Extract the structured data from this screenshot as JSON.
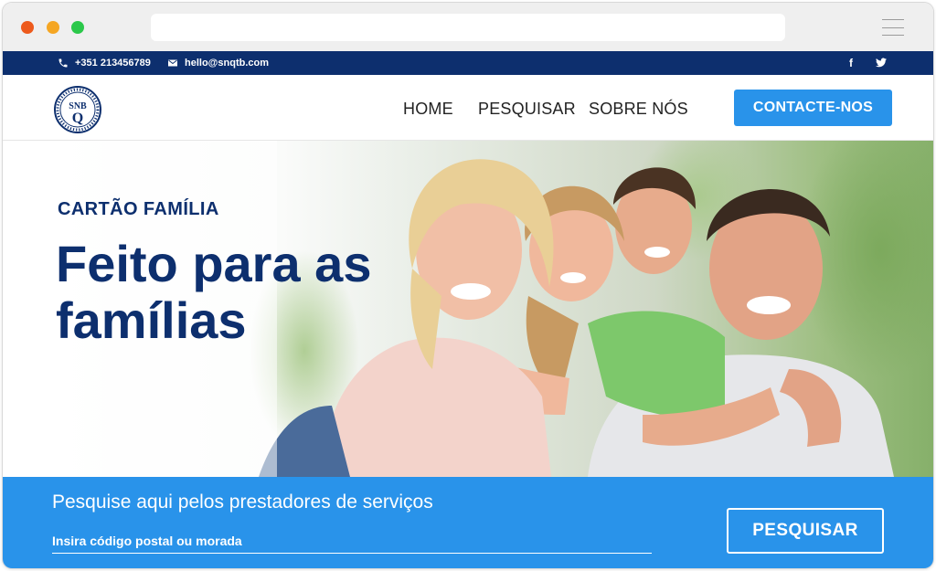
{
  "topbar": {
    "phone": "+351 213456789",
    "email": "hello@snqtb.com",
    "social": {
      "facebook": "f",
      "twitter": "t"
    }
  },
  "header": {
    "logo_text": "SNQTB",
    "nav": [
      {
        "label": "HOME"
      },
      {
        "label": "PESQUISAR"
      },
      {
        "label": "SOBRE NÓS"
      }
    ],
    "cta_label": "CONTACTE-NOS"
  },
  "hero": {
    "kicker": "CARTÃO FAMÍLIA",
    "title": "Feito para as famílias"
  },
  "search": {
    "title": "Pesquise aqui pelos prestadores de serviços",
    "placeholder": "Insira código postal ou morada",
    "button_label": "PESQUISAR"
  },
  "colors": {
    "navy": "#0d2f6e",
    "accent_blue": "#2993ea",
    "chrome_bg": "#efefef"
  },
  "icons": [
    "phone-icon",
    "mail-icon",
    "facebook-icon",
    "twitter-icon",
    "menu-icon"
  ]
}
